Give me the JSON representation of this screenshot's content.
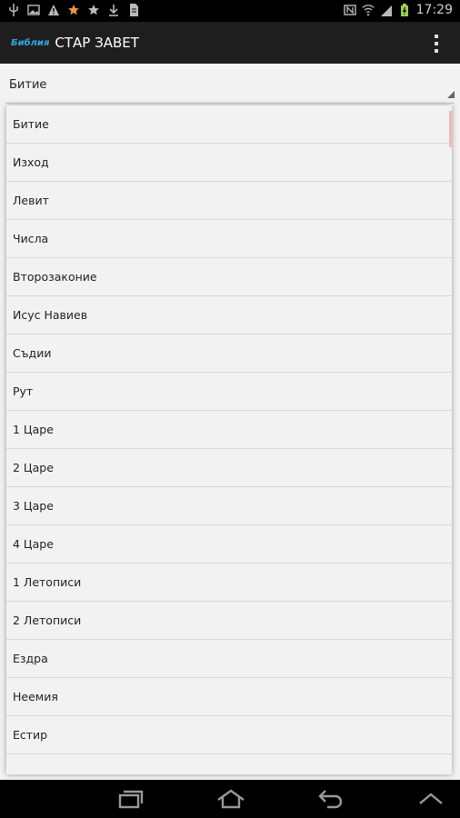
{
  "status_bar": {
    "time": "17:29",
    "icons": [
      "usb-icon",
      "image-icon",
      "warning-icon",
      "star-icon",
      "star-icon",
      "download-icon",
      "file-icon"
    ],
    "right_icons": [
      "nfc-icon",
      "wifi-icon",
      "signal-icon",
      "battery-icon"
    ]
  },
  "action_bar": {
    "brand": "Библия",
    "title": "СТАР ЗАВЕТ"
  },
  "spinner": {
    "selected": "Битие"
  },
  "books": [
    "Битие",
    "Изход",
    "Левит",
    "Числа",
    "Второзаконие",
    "Исус Навиев",
    "Съдии",
    "Рут",
    "1 Царе",
    "2 Царе",
    "3 Царе",
    "4 Царе",
    "1 Летописи",
    "2 Летописи",
    "Ездра",
    "Неемия",
    "Естир"
  ],
  "colors": {
    "accent": "#2fa8e0",
    "background": "#f2f2f2",
    "bar": "#1e1e1e"
  }
}
